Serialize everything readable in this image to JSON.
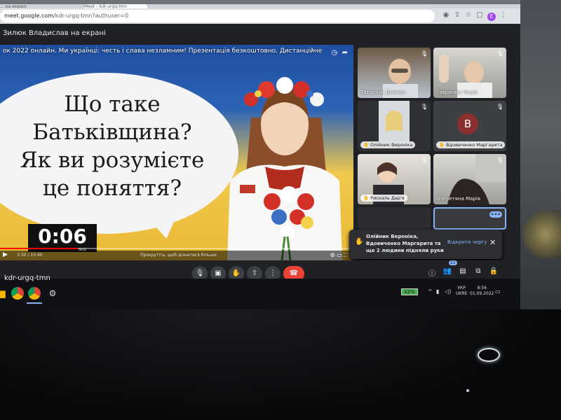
{
  "browser": {
    "tabs": [
      {
        "label": "... на екрані"
      },
      {
        "label": "Meet – kdr-urgq-tmn"
      }
    ],
    "address_host": "meet.google.com",
    "address_path": "/kdr-urgq-tmn?authuser=0",
    "profile_initial": "E"
  },
  "meet_header": {
    "title": "Зилюк Владислав на екрані"
  },
  "presentation": {
    "video_title": "ок 2022 онлайн. Ми українці: честь і слава незламним! Презентація безкоштовно. Дистанційне",
    "slide_lines": [
      "Що таке",
      "Батьківщина?",
      "Як ви розумієте",
      "це поняття?"
    ],
    "timer": "0:06",
    "timer_sub": "Skip",
    "time_label": "3:30 / 15:40",
    "scroll_hint": "Прокрутіть, щоб дізнатися більше",
    "progress_fraction": 0.22
  },
  "participants": [
    {
      "name": "Татарчук Дмитро",
      "mic": "muted"
    },
    {
      "name": "Гаврилюк Надія",
      "mic": "muted"
    },
    {
      "name": "Олійник Вероніка",
      "mic": "muted",
      "raised_hand": true
    },
    {
      "name": "Вдовиченко Маргарита",
      "mic": "muted",
      "raised_hand": true,
      "avatar": "В"
    },
    {
      "name": "Рискаль Дар'я",
      "mic": "muted",
      "raised_hand": true
    },
    {
      "name": "Очеретяна Марія",
      "mic": "muted"
    },
    {
      "name": "",
      "mic": ""
    },
    {
      "name": "",
      "mic": "speaking"
    }
  ],
  "notification": {
    "text": "Олійник Вероніка, Вдовиченко Маргарита та ще 2 людини підняли руки",
    "action": "Відкрити чергу"
  },
  "controls": {
    "meeting_code": "kdr-urgq-tmn",
    "participants_badge": "22"
  },
  "taskbar": {
    "battery": "32%",
    "lang_top": "УКР",
    "lang_bottom": "UKRE",
    "time": "8:56",
    "date": "01.09.2022"
  },
  "colors": {
    "meet_bg": "#202124",
    "end_call": "#ea4335",
    "accent": "#8ab4f8",
    "flag_blue": "#2d63b6",
    "flag_yellow": "#f2c94c"
  },
  "icons": [
    "mic-icon",
    "camera-icon",
    "hand-icon",
    "present-icon",
    "more-icon",
    "end-call-icon",
    "info-icon",
    "people-icon",
    "chat-icon",
    "activities-icon",
    "lock-icon"
  ]
}
